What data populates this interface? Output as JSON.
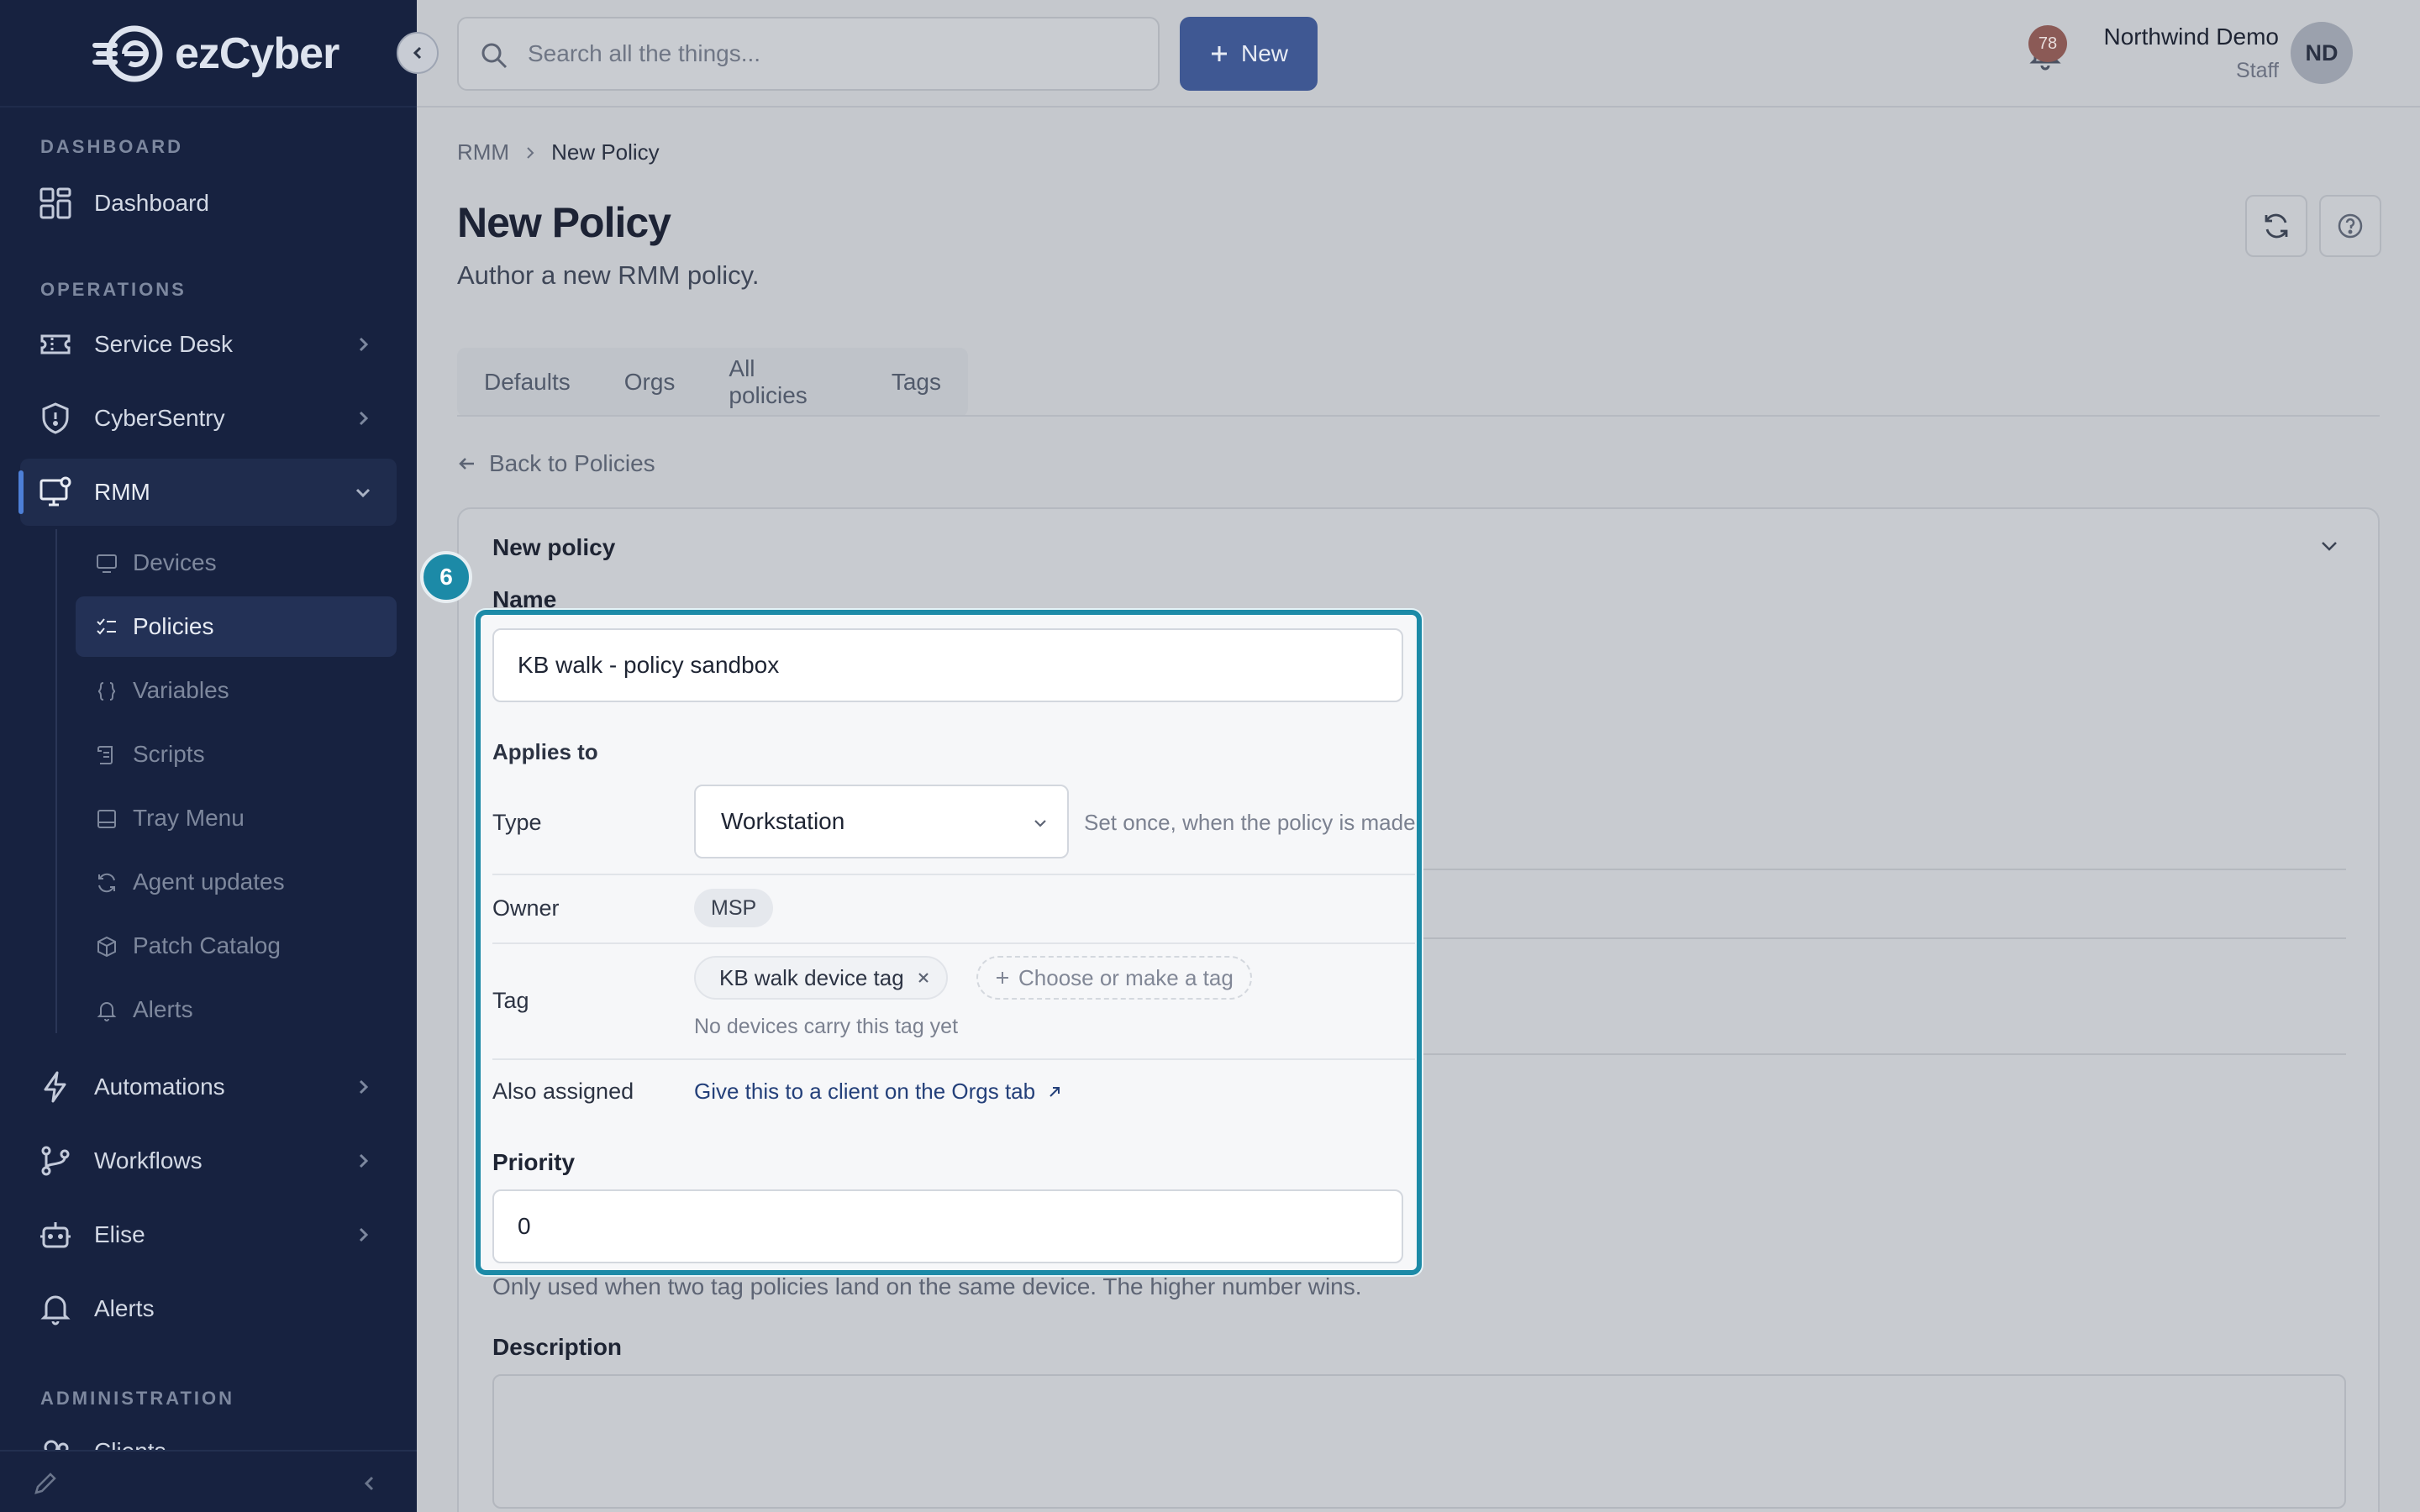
{
  "brand": {
    "name": "ezCyber"
  },
  "sidebar": {
    "sections": {
      "dashboard": "DASHBOARD",
      "operations": "OPERATIONS",
      "administration": "ADMINISTRATION"
    },
    "items": {
      "dashboard": "Dashboard",
      "service_desk": "Service Desk",
      "cybersentry": "CyberSentry",
      "rmm": "RMM",
      "automations": "Automations",
      "workflows": "Workflows",
      "elise": "Elise",
      "alerts": "Alerts",
      "clients": "Clients"
    },
    "rmm_sub": [
      "Devices",
      "Policies",
      "Variables",
      "Scripts",
      "Tray Menu",
      "Agent updates",
      "Patch Catalog",
      "Alerts"
    ]
  },
  "topbar": {
    "search_placeholder": "Search all the things...",
    "new_label": "New",
    "notification_count": "78",
    "user_name": "Northwind Demo",
    "user_role": "Staff",
    "avatar_initials": "ND"
  },
  "page": {
    "breadcrumb": [
      "RMM",
      "New Policy"
    ],
    "title": "New Policy",
    "subtitle": "Author a new RMM policy.",
    "tabs": [
      "Defaults",
      "Orgs",
      "All policies",
      "Tags"
    ],
    "back_link": "Back to Policies"
  },
  "form": {
    "card_title": "New policy",
    "step_number": "6",
    "name_label": "Name",
    "name_value": "KB walk - policy sandbox",
    "applies_to": "Applies to",
    "type_label": "Type",
    "type_value": "Workstation",
    "type_hint": "Set once, when the policy is made",
    "owner_label": "Owner",
    "owner_value": "MSP",
    "tag_label": "Tag",
    "tag_value": "KB walk device tag",
    "tag_add": "Choose or make a tag",
    "tag_hint": "No devices carry this tag yet",
    "also_label": "Also assigned",
    "also_link": "Give this to a client on the Orgs tab",
    "priority_label": "Priority",
    "priority_value": "0",
    "priority_hint": "Only used when two tag policies land on the same device. The higher number wins.",
    "description_label": "Description"
  },
  "colors": {
    "sidebar_bg": "#172240",
    "accent": "#1c8aa7",
    "primary_button": "#3f5893"
  }
}
